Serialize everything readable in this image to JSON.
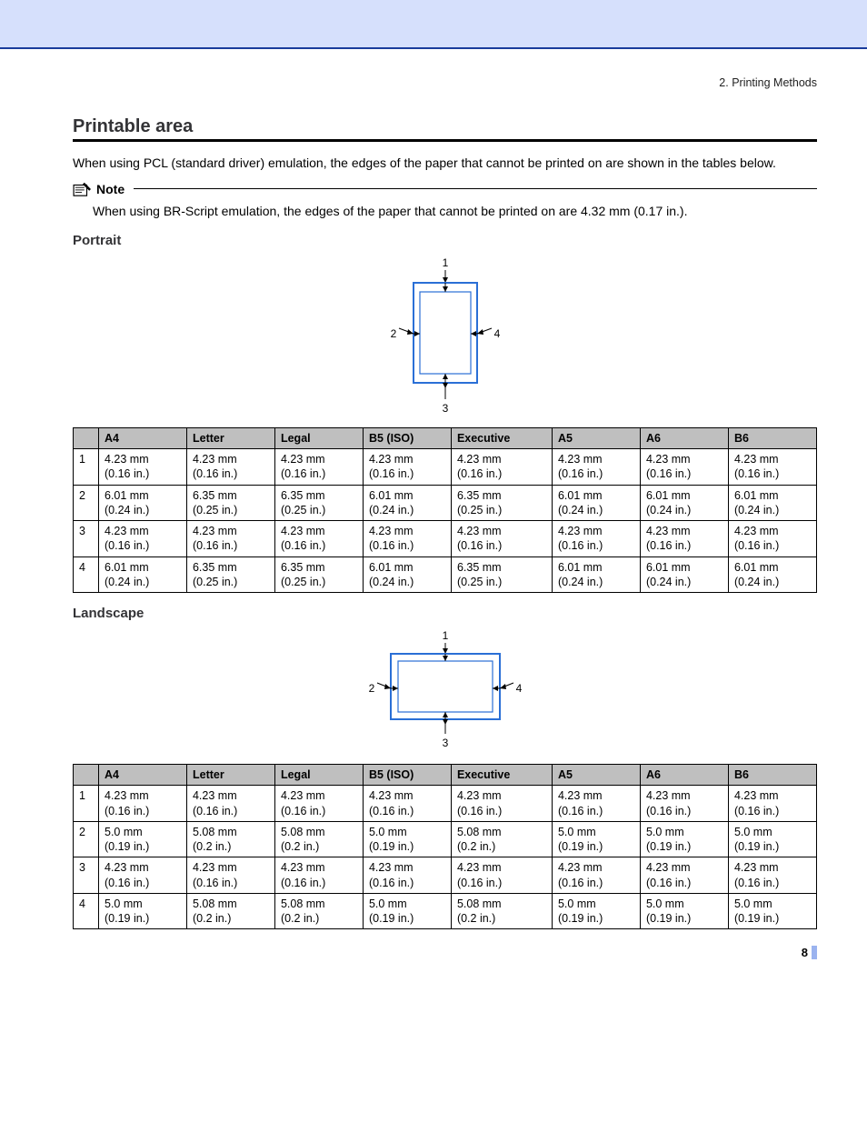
{
  "breadcrumb": "2. Printing Methods",
  "title": "Printable area",
  "intro": "When using PCL (standard driver) emulation, the edges of the paper that cannot be printed on are shown in the tables below.",
  "note_label": "Note",
  "note_text": "When using BR-Script emulation, the edges of the paper that cannot be printed on are 4.32 mm (0.17 in.).",
  "portrait_heading": "Portrait",
  "landscape_heading": "Landscape",
  "diagram": {
    "label_top": "1",
    "label_left": "2",
    "label_bottom": "3",
    "label_right": "4"
  },
  "table_headers": [
    "",
    "A4",
    "Letter",
    "Legal",
    "B5 (ISO)",
    "Executive",
    "A5",
    "A6",
    "B6"
  ],
  "portrait_rows": [
    {
      "edge": "1",
      "cells": [
        {
          "mm": "4.23 mm",
          "in": "(0.16 in.)"
        },
        {
          "mm": "4.23 mm",
          "in": "(0.16 in.)"
        },
        {
          "mm": "4.23 mm",
          "in": "(0.16 in.)"
        },
        {
          "mm": "4.23 mm",
          "in": "(0.16 in.)"
        },
        {
          "mm": "4.23 mm",
          "in": "(0.16 in.)"
        },
        {
          "mm": "4.23 mm",
          "in": "(0.16 in.)"
        },
        {
          "mm": "4.23 mm",
          "in": "(0.16 in.)"
        },
        {
          "mm": "4.23 mm",
          "in": "(0.16 in.)"
        }
      ]
    },
    {
      "edge": "2",
      "cells": [
        {
          "mm": "6.01 mm",
          "in": "(0.24 in.)"
        },
        {
          "mm": "6.35 mm",
          "in": "(0.25 in.)"
        },
        {
          "mm": "6.35 mm",
          "in": "(0.25 in.)"
        },
        {
          "mm": "6.01 mm",
          "in": "(0.24 in.)"
        },
        {
          "mm": "6.35 mm",
          "in": "(0.25 in.)"
        },
        {
          "mm": "6.01 mm",
          "in": "(0.24 in.)"
        },
        {
          "mm": "6.01 mm",
          "in": "(0.24 in.)"
        },
        {
          "mm": "6.01 mm",
          "in": "(0.24 in.)"
        }
      ]
    },
    {
      "edge": "3",
      "cells": [
        {
          "mm": "4.23 mm",
          "in": "(0.16 in.)"
        },
        {
          "mm": "4.23 mm",
          "in": "(0.16 in.)"
        },
        {
          "mm": "4.23 mm",
          "in": "(0.16 in.)"
        },
        {
          "mm": "4.23 mm",
          "in": "(0.16 in.)"
        },
        {
          "mm": "4.23 mm",
          "in": "(0.16 in.)"
        },
        {
          "mm": "4.23 mm",
          "in": "(0.16 in.)"
        },
        {
          "mm": "4.23 mm",
          "in": "(0.16 in.)"
        },
        {
          "mm": "4.23 mm",
          "in": "(0.16 in.)"
        }
      ]
    },
    {
      "edge": "4",
      "cells": [
        {
          "mm": "6.01 mm",
          "in": "(0.24 in.)"
        },
        {
          "mm": "6.35 mm",
          "in": "(0.25 in.)"
        },
        {
          "mm": "6.35 mm",
          "in": "(0.25 in.)"
        },
        {
          "mm": "6.01 mm",
          "in": "(0.24 in.)"
        },
        {
          "mm": "6.35 mm",
          "in": "(0.25 in.)"
        },
        {
          "mm": "6.01 mm",
          "in": "(0.24 in.)"
        },
        {
          "mm": "6.01 mm",
          "in": "(0.24 in.)"
        },
        {
          "mm": "6.01 mm",
          "in": "(0.24 in.)"
        }
      ]
    }
  ],
  "landscape_rows": [
    {
      "edge": "1",
      "cells": [
        {
          "mm": "4.23 mm",
          "in": "(0.16 in.)"
        },
        {
          "mm": "4.23 mm",
          "in": "(0.16 in.)"
        },
        {
          "mm": "4.23 mm",
          "in": "(0.16 in.)"
        },
        {
          "mm": "4.23 mm",
          "in": "(0.16 in.)"
        },
        {
          "mm": "4.23 mm",
          "in": "(0.16 in.)"
        },
        {
          "mm": "4.23 mm",
          "in": "(0.16 in.)"
        },
        {
          "mm": "4.23 mm",
          "in": "(0.16 in.)"
        },
        {
          "mm": "4.23 mm",
          "in": "(0.16 in.)"
        }
      ]
    },
    {
      "edge": "2",
      "cells": [
        {
          "mm": "5.0 mm",
          "in": "(0.19 in.)"
        },
        {
          "mm": "5.08 mm",
          "in": "(0.2 in.)"
        },
        {
          "mm": "5.08 mm",
          "in": "(0.2 in.)"
        },
        {
          "mm": "5.0 mm",
          "in": "(0.19 in.)"
        },
        {
          "mm": "5.08 mm",
          "in": "(0.2 in.)"
        },
        {
          "mm": "5.0 mm",
          "in": "(0.19 in.)"
        },
        {
          "mm": "5.0 mm",
          "in": "(0.19 in.)"
        },
        {
          "mm": "5.0 mm",
          "in": "(0.19 in.)"
        }
      ]
    },
    {
      "edge": "3",
      "cells": [
        {
          "mm": "4.23 mm",
          "in": "(0.16 in.)"
        },
        {
          "mm": "4.23 mm",
          "in": "(0.16 in.)"
        },
        {
          "mm": "4.23 mm",
          "in": "(0.16 in.)"
        },
        {
          "mm": "4.23 mm",
          "in": "(0.16 in.)"
        },
        {
          "mm": "4.23 mm",
          "in": "(0.16 in.)"
        },
        {
          "mm": "4.23 mm",
          "in": "(0.16 in.)"
        },
        {
          "mm": "4.23 mm",
          "in": "(0.16 in.)"
        },
        {
          "mm": "4.23 mm",
          "in": "(0.16 in.)"
        }
      ]
    },
    {
      "edge": "4",
      "cells": [
        {
          "mm": "5.0 mm",
          "in": "(0.19 in.)"
        },
        {
          "mm": "5.08 mm",
          "in": "(0.2 in.)"
        },
        {
          "mm": "5.08 mm",
          "in": "(0.2 in.)"
        },
        {
          "mm": "5.0 mm",
          "in": "(0.19 in.)"
        },
        {
          "mm": "5.08 mm",
          "in": "(0.2 in.)"
        },
        {
          "mm": "5.0 mm",
          "in": "(0.19 in.)"
        },
        {
          "mm": "5.0 mm",
          "in": "(0.19 in.)"
        },
        {
          "mm": "5.0 mm",
          "in": "(0.19 in.)"
        }
      ]
    }
  ],
  "page_number": "8"
}
